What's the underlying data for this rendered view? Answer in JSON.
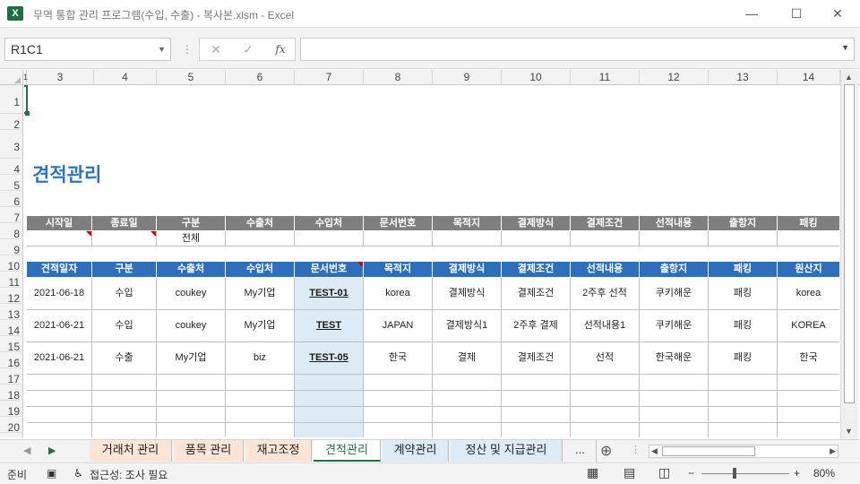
{
  "window": {
    "title": "무역 통합 관리 프로그램(수입, 수출) - 복사본.xlsm  -  Excel",
    "app_icon": "X",
    "minimize": "—",
    "restore": "☐",
    "close": "✕"
  },
  "formula_bar": {
    "name_box": "R1C1",
    "cancel": "✕",
    "enter": "✓",
    "fx": "fx",
    "value": ""
  },
  "columns": [
    "1",
    "3",
    "4",
    "5",
    "6",
    "7",
    "8",
    "9",
    "10",
    "11",
    "12",
    "13",
    "14"
  ],
  "rows": [
    "1",
    "2",
    "3",
    "4",
    "5",
    "6",
    "7",
    "8",
    "9",
    "10",
    "11",
    "12",
    "13",
    "14",
    "15",
    "16",
    "17",
    "18",
    "19",
    "20"
  ],
  "sheet": {
    "title": "견적관리",
    "filter_headers": [
      "시작일",
      "종료일",
      "구분",
      "수출처",
      "수입처",
      "문서번호",
      "목적지",
      "결제방식",
      "결제조건",
      "선적내용",
      "출항지",
      "패킹"
    ],
    "filter_values": [
      "",
      "",
      "전체",
      "",
      "",
      "",
      "",
      "",
      "",
      "",
      "",
      ""
    ],
    "list_headers": [
      "견적일자",
      "구분",
      "수출처",
      "수입처",
      "문서번호",
      "목적지",
      "결제방식",
      "결제조건",
      "선적내용",
      "출항지",
      "패킹",
      "원산지"
    ],
    "records": [
      [
        "2021-06-18",
        "수입",
        "coukey",
        "My기업",
        "TEST-01",
        "korea",
        "결제방식",
        "결제조건",
        "2주후 선적",
        "쿠키해운",
        "패킹",
        "korea"
      ],
      [
        "2021-06-21",
        "수입",
        "coukey",
        "My기업",
        "TEST",
        "JAPAN",
        "결제방식1",
        "2주후 결제",
        "선적내용1",
        "쿠키해운",
        "패킹",
        "KOREA"
      ],
      [
        "2021-06-21",
        "수출",
        "My기업",
        "biz",
        "TEST-05",
        "한국",
        "결제",
        "결제조건",
        "선적",
        "한국해운",
        "패킹",
        "한국"
      ]
    ]
  },
  "tabs": [
    "거래처 관리",
    "품목 관리",
    "재고조정",
    "견적관리",
    "계약관리",
    "정산 및 지급관리",
    "..."
  ],
  "tab_colors": [
    "#fce4d6",
    "#fce4d6",
    "#fce4d6",
    "#ffffff",
    "#ddebf7",
    "#ddebf7",
    "#f3f3f3"
  ],
  "status": {
    "ready": "준비",
    "accessibility": "접근성: 조사 필요",
    "zoom": "80%",
    "zoom_minus": "−",
    "zoom_plus": "+"
  },
  "colors": {
    "accent": "#1e7145",
    "title_blue": "#2e75b6",
    "header_blue": "#2e6fbc",
    "header_gray": "#7f7f7f"
  }
}
